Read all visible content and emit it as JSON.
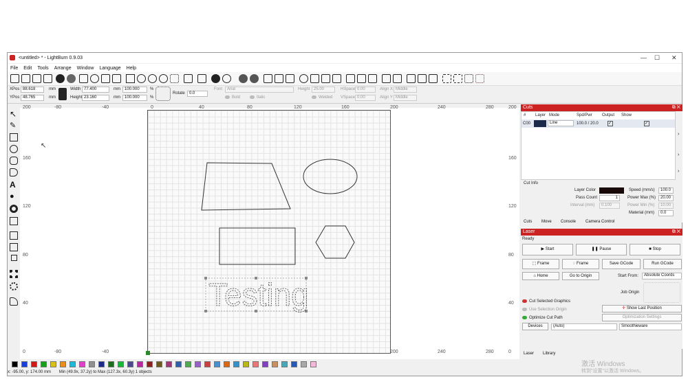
{
  "window": {
    "title": "<untitled> * - LightBurn 0.9.03",
    "min": "—",
    "max": "☐",
    "close": "✕"
  },
  "menu": [
    "File",
    "Edit",
    "Tools",
    "Arrange",
    "Window",
    "Language",
    "Help"
  ],
  "props": {
    "xpos_label": "XPos",
    "xpos": "88.618",
    "ypos_label": "YPos",
    "ypos": "48.765",
    "unit": "mm",
    "width_label": "Width",
    "width": "77.400",
    "height_label": "Height",
    "height": "23.160",
    "pct1": "100.000",
    "pct2": "100.000",
    "pct": "%",
    "rotate_label": "Rotate",
    "rotate": "0.0",
    "font_label": "Font",
    "font": "Arial",
    "fheight_label": "Height",
    "fheight": "25.00",
    "hspace_label": "HSpace",
    "hspace": "0.00",
    "vspace_label": "VSpace",
    "vspace": "0.00",
    "alignx_label": "Align X",
    "alignx": "Middle",
    "aligny_label": "Align Y",
    "aligny": "Middle",
    "bold": "Bold",
    "italic": "Italic",
    "welded": "Welded"
  },
  "rulers": {
    "x": [
      "-80",
      "-40",
      "0",
      "40",
      "80",
      "120",
      "160",
      "200",
      "240",
      "280"
    ],
    "y_left": [
      "200",
      "160",
      "120",
      "80",
      "40",
      "0"
    ],
    "y_right": [
      "200",
      "160",
      "120",
      "80",
      "40",
      "0"
    ]
  },
  "canvas_text": "Testing",
  "palette_colors": [
    "#000000",
    "#1a3ed8",
    "#d01818",
    "#18a018",
    "#d8c018",
    "#e8901c",
    "#20b8d8",
    "#e040c8",
    "#909090",
    "#1c2a8c",
    "#1e6c1e",
    "#18b838",
    "#4a4a8c",
    "#b828a0",
    "#8a2020",
    "#6a5a20",
    "#a03878",
    "#3060a8",
    "#50a850",
    "#9860c8",
    "#c84040",
    "#4890d0",
    "#d86818",
    "#3890c8",
    "#b8b818",
    "#e87878",
    "#8040c0",
    "#c89060",
    "#48a8b8",
    "#2858b0",
    "#a8a8a8",
    "#f4b8d8"
  ],
  "status": {
    "coords": "x: -95.00, y: 174.00 mm",
    "bounds": "Min (49.9x, 37.2y) to Max (127.3x, 60.3y)  1 objects"
  },
  "cuts": {
    "header": "Cuts",
    "cols": [
      "#",
      "Layer",
      "Mode",
      "Spd/Pwr",
      "Output",
      "Show"
    ],
    "row": {
      "num": "C00",
      "mode": "Line",
      "spd": "100.0 / 20.0"
    },
    "layer_color": "#1a2a48"
  },
  "cutinfo": {
    "title": "Cut Info",
    "layer_color": "Layer Color",
    "pass_count": "Pass Count",
    "pass_val": "1",
    "interval": "Interval (mm)",
    "interval_val": "0.100",
    "speed": "Speed (mm/s)",
    "speed_val": "100.0",
    "pmax": "Power Max (%)",
    "pmax_val": "20.00",
    "pmin": "Power Min (%)",
    "pmin_val": "10.00",
    "material": "Material (mm)",
    "material_val": "0.0",
    "swatch": "#180808"
  },
  "tabs1": [
    "Cuts",
    "Move",
    "Console",
    "Camera Control"
  ],
  "laser": {
    "header": "Laser",
    "state": "Ready",
    "start": "Start",
    "pause": "Pause",
    "stop": "Stop",
    "frame1": "Frame",
    "frame2": "Frame",
    "save": "Save GCode",
    "run": "Run GCode",
    "home": "Home",
    "origin": "Go to Origin",
    "start_from": "Start From:",
    "start_val": "Absolute Coords",
    "job_origin": "Job Origin",
    "cut_sel": "Cut Selected Graphics",
    "use_sel": "Use Selection Origin",
    "show_last": "Show Last Position",
    "optimize": "Optimize Cut Path",
    "opt_settings": "Optimization Settings",
    "devices": "Devices",
    "auto": "(Auto)",
    "device": "Smoothieware"
  },
  "tabs2": [
    "Laser",
    "Library"
  ],
  "watermark": {
    "line1": "激活 Windows",
    "line2": "转到\"设置\"以激活 Windows。"
  }
}
